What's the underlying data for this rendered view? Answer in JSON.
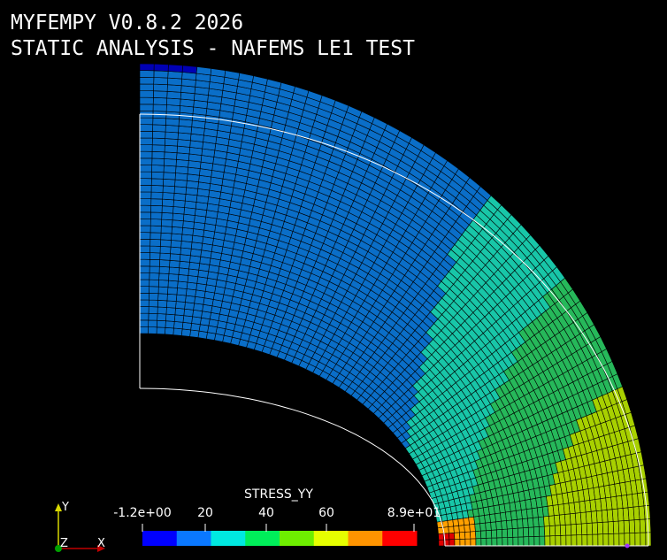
{
  "title": {
    "line1": "MYFEMPY V0.8.2 2026",
    "line2": "STATIC ANALYSIS - NAFEMS LE1 TEST"
  },
  "scalar_bar": {
    "title": "STRESS_YY",
    "tick_labels": [
      "-1.2e+00",
      "20",
      "40",
      "60",
      "8.9e+01"
    ],
    "range": [
      -1.2,
      89
    ],
    "colors": [
      "#0000ff",
      "#0a78ff",
      "#00e8e0",
      "#00ee5a",
      "#6eee00",
      "#e6ff00",
      "#ff9400",
      "#ff0000"
    ]
  },
  "axes": {
    "x": "X",
    "y": "Y",
    "z": "Z"
  },
  "field_colors": {
    "deep_blue": "#0000b4",
    "mid_blue": "#0a6ec8",
    "cyan": "#18c6a8",
    "green": "#26b85a",
    "yellow_green": "#a8d000",
    "orange": "#ffa000",
    "red": "#e00000"
  }
}
